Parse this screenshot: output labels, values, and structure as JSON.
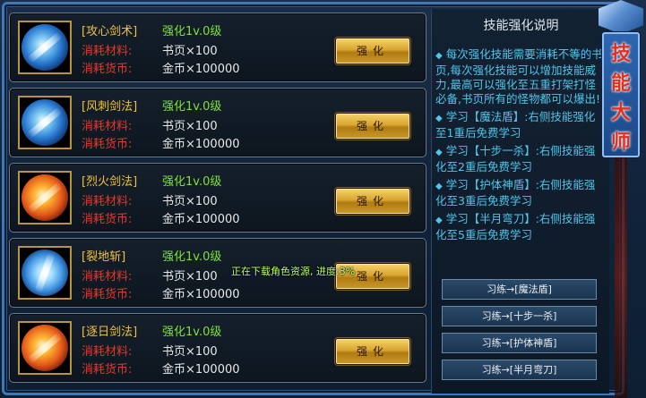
{
  "skills": [
    {
      "name": "[攻心剑术]",
      "level": "强化1v.0级",
      "material_label": "消耗材料:",
      "material_value": "书页×100",
      "currency_label": "消耗货币:",
      "currency_value": "金币×100000",
      "button": "强化",
      "icon": "sword-strike-blue-icon"
    },
    {
      "name": "[风刺剑法]",
      "level": "强化1v.0级",
      "material_label": "消耗材料:",
      "material_value": "书页×100",
      "currency_label": "消耗货币:",
      "currency_value": "金币×100000",
      "button": "强化",
      "icon": "wind-thrust-blue-icon"
    },
    {
      "name": "[烈火剑法]",
      "level": "强化1v.0级",
      "material_label": "消耗材料:",
      "material_value": "书页×100",
      "currency_label": "消耗货币:",
      "currency_value": "金币×100000",
      "button": "强化",
      "icon": "fire-sword-icon"
    },
    {
      "name": "[裂地斩]",
      "level": "强化1v.0级",
      "material_label": "消耗材料:",
      "material_value": "书页×100",
      "currency_label": "消耗货币:",
      "currency_value": "金币×100000",
      "button": "强化",
      "icon": "earth-split-ice-icon"
    },
    {
      "name": "[逐日剑法]",
      "level": "强化1v.0级",
      "material_label": "消耗材料:",
      "material_value": "书页×100",
      "currency_label": "消耗货币:",
      "currency_value": "金币×100000",
      "button": "强化",
      "icon": "sun-chase-fire-icon"
    }
  ],
  "info": {
    "title": "技能强化说明",
    "paragraphs": [
      "每次强化技能需要消耗不等的书页,每次强化技能可以增加技能威力,最高可以强化至五重打架打怪必备,书页所有的怪物都可以爆出!",
      "学习【魔法盾】:右侧技能强化至1重后免费学习",
      "学习【十步一杀】:右侧技能强化至2重后免费学习",
      "学习【护体神盾】:右侧技能强化至3重后免费学习",
      "学习【半月弯刀】:右侧技能强化至5重后免费学习"
    ],
    "train_buttons": [
      "习练→[魔法盾]",
      "习练→[十步一杀]",
      "习练→[护体神盾]",
      "习练→[半月弯刀]"
    ]
  },
  "banner": {
    "chars": [
      "技",
      "能",
      "大",
      "师"
    ]
  },
  "status": {
    "download_text": "正在下载角色资源, 进度:3%"
  },
  "colors": {
    "frame": "#3f78b8",
    "skill_name": "#f0c040",
    "label_red": "#e03a2a",
    "level_green": "#7ee03a",
    "info_text": "#4fc6ea",
    "button_gold": "#d9a531",
    "banner_char": "#e13020"
  }
}
